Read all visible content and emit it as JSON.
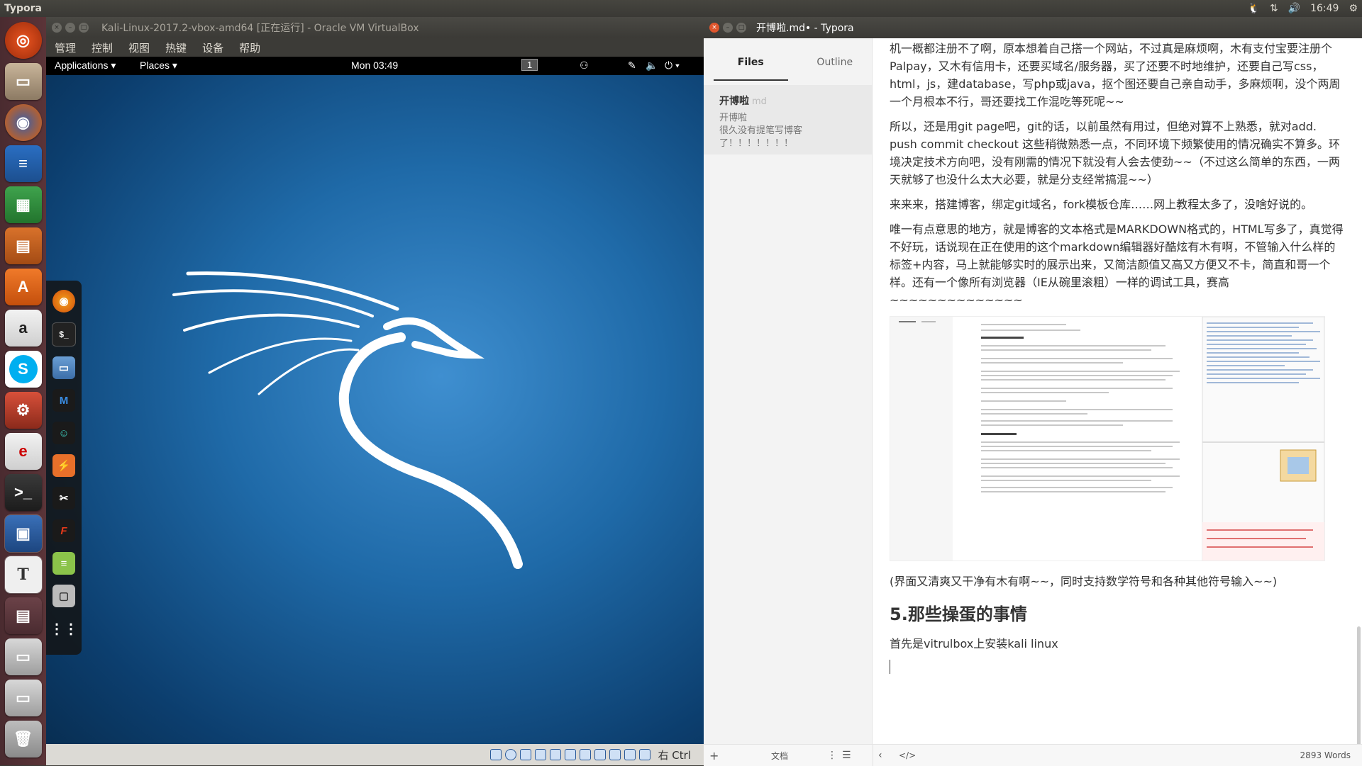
{
  "top_panel": {
    "app_name": "Typora",
    "time": "16:49"
  },
  "vbox": {
    "title": "Kali-Linux-2017.2-vbox-amd64 [正在运行] - Oracle VM VirtualBox",
    "menu": [
      "管理",
      "控制",
      "视图",
      "热键",
      "设备",
      "帮助"
    ],
    "status_host_key": "右 Ctrl"
  },
  "guest": {
    "applications": "Applications",
    "places": "Places",
    "clock": "Mon 03:49",
    "workspace": "1"
  },
  "typora": {
    "title": "开博啦.md• - Typora",
    "tab_files": "Files",
    "tab_outline": "Outline",
    "file_name": "开博啦",
    "file_ext": "md",
    "file_preview_line1": "开博啦",
    "file_preview_line2": "很久没有提笔写博客",
    "file_preview_line3": "了！！！！！！！",
    "footer_doc_label": "文档",
    "word_count": "2893 Words",
    "paragraphs": [
      "机一概都注册不了啊，原本想着自己搭一个网站，不过真是麻烦啊，木有支付宝要注册个Palpay，又木有信用卡，还要买域名/服务器，买了还要不时地维护，还要自己写css，html，js，建database，写php或java，抠个图还要自己亲自动手，多麻烦啊，没个两周一个月根本不行，哥还要找工作混吃等死呢~~",
      "所以，还是用git page吧，git的话，以前虽然有用过，但绝对算不上熟悉，就对add. push commit  checkout 这些稍微熟悉一点，不同环境下频繁使用的情况确实不算多。环境决定技术方向吧，没有刚需的情况下就没有人会去使劲~~（不过这么简单的东西，一两天就够了也没什么太大必要，就是分支经常搞混~~）",
      "来来来，搭建博客，绑定git域名，fork模板仓库……网上教程太多了，没啥好说的。",
      "唯一有点意思的地方，就是博客的文本格式是MARKDOWN格式的，HTML写多了，真觉得不好玩，话说现在正在使用的这个markdown编辑器好酷炫有木有啊，不管输入什么样的标签+内容，马上就能够实时的展示出来，又简洁颜值又高又方便又不卡，简直和哥一个样。还有一个像所有浏览器（IE从碗里滚粗）一样的调试工具，赛高~~~~~~~~~~~~~~"
    ],
    "caption": "(界面又清爽又干净有木有啊~~，同时支持数学符号和各种其他符号输入~~)",
    "heading": "5.那些操蛋的事情",
    "last_paragraph": "首先是vitrulbox上安装kali linux"
  },
  "colors": {
    "ubuntu_panel": "#3c3b37",
    "launcher": "#5b3438",
    "kali_blue": "#1f6aa8",
    "close_orange": "#e0562d"
  }
}
